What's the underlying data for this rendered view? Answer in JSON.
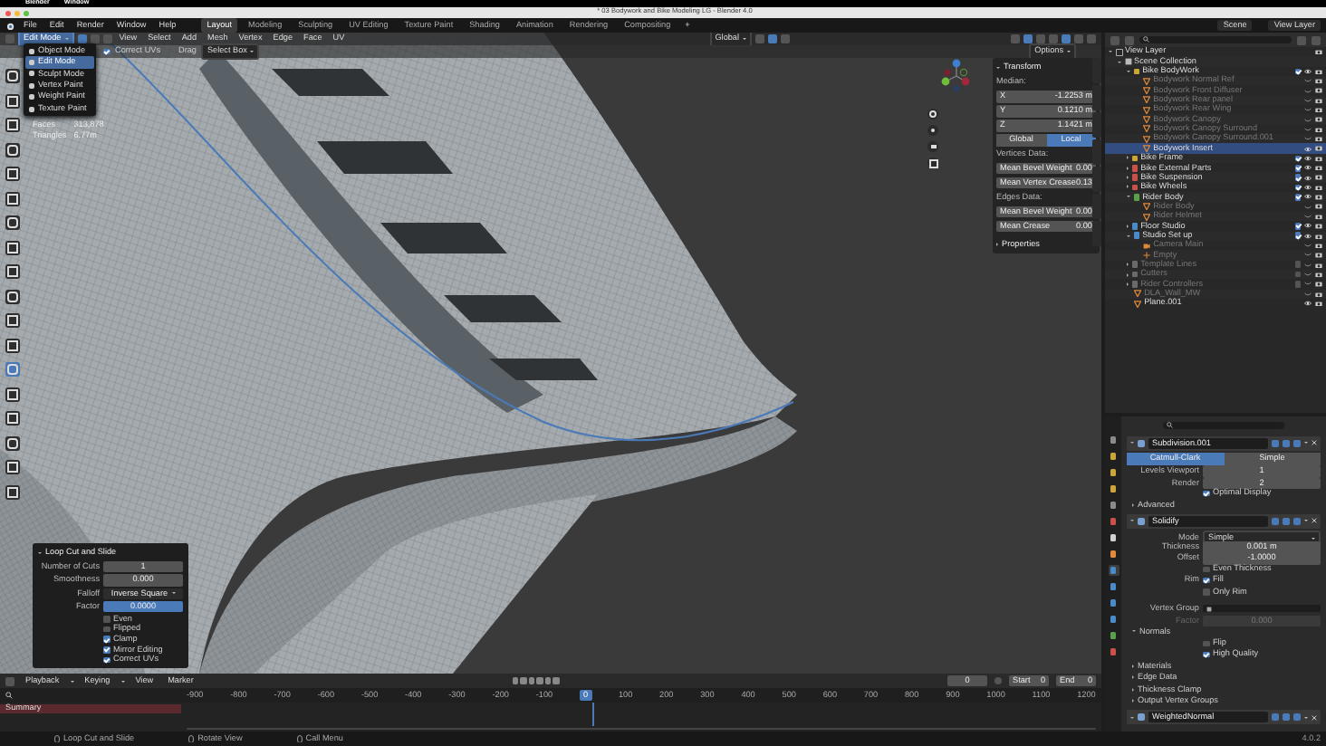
{
  "os_menu": [
    "Blender",
    "Window"
  ],
  "window": {
    "title": "* 03 Bodywork and Bike Modeling LG - Blender 4.0"
  },
  "menu": [
    "File",
    "Edit",
    "Render",
    "Window",
    "Help"
  ],
  "workspaces": [
    {
      "label": "Layout",
      "selected": true
    },
    {
      "label": "Modeling",
      "selected": false
    },
    {
      "label": "Sculpting",
      "selected": false
    },
    {
      "label": "UV Editing",
      "selected": false
    },
    {
      "label": "Texture Paint",
      "selected": false
    },
    {
      "label": "Shading",
      "selected": false
    },
    {
      "label": "Animation",
      "selected": false
    },
    {
      "label": "Rendering",
      "selected": false
    },
    {
      "label": "Compositing",
      "selected": false
    }
  ],
  "add_workspace": "+",
  "scene": "Scene",
  "view_layer": "View Layer",
  "viewport": {
    "mode": "Edit Mode",
    "menus": [
      "View",
      "Select",
      "Add",
      "Mesh",
      "Vertex",
      "Edge",
      "Face",
      "UV"
    ],
    "orientation": "Global",
    "options": "Options",
    "tool_settings": {
      "correct_uvs": {
        "label": "Correct UVs",
        "checked": true
      },
      "drag_label": "Drag",
      "drag_value": "Select Box"
    },
    "mode_menu": [
      {
        "label": "Object Mode",
        "selected": false
      },
      {
        "label": "Edit Mode",
        "selected": true
      },
      {
        "label": "Sculpt Mode",
        "selected": false
      },
      {
        "label": "Vertex Paint",
        "selected": false
      },
      {
        "label": "Weight Paint",
        "selected": false
      },
      {
        "label": "Texture Paint",
        "selected": false
      }
    ],
    "stats": [
      {
        "label": "Faces",
        "value": "313,878"
      },
      {
        "label": "Triangles",
        "value": "6.77m"
      }
    ],
    "sidebar": {
      "title": "Transform",
      "median_label": "Median:",
      "coords": [
        {
          "axis": "X",
          "value": "-1.2253 m"
        },
        {
          "axis": "Y",
          "value": "0.1210 m"
        },
        {
          "axis": "Z",
          "value": "1.1421 m"
        }
      ],
      "space": [
        {
          "label": "Global",
          "selected": false
        },
        {
          "label": "Local",
          "selected": true
        }
      ],
      "sections": [
        {
          "title": "Vertices Data:",
          "rows": [
            {
              "label": "Mean Bevel Weight",
              "value": "0.00"
            },
            {
              "label": "Mean Vertex Crease",
              "value": "0.13"
            }
          ]
        },
        {
          "title": "Edges Data:",
          "rows": [
            {
              "label": "Mean Bevel Weight",
              "value": "0.00"
            },
            {
              "label": "Mean Crease",
              "value": "0.00"
            }
          ]
        }
      ],
      "properties_title": "Properties"
    },
    "operator_panel": {
      "title": "Loop Cut and Slide",
      "fields": [
        {
          "label": "Number of Cuts",
          "value": "1",
          "kind": "number"
        },
        {
          "label": "Smoothness",
          "value": "0.000",
          "kind": "number"
        },
        {
          "label": "Falloff",
          "value": "Inverse Square",
          "kind": "dropdown"
        },
        {
          "label": "Factor",
          "value": "0.0000",
          "kind": "active"
        }
      ],
      "options": [
        {
          "label": "Even",
          "checked": false
        },
        {
          "label": "Flipped",
          "checked": false
        },
        {
          "label": "Clamp",
          "checked": true
        },
        {
          "label": "Mirror Editing",
          "checked": true
        },
        {
          "label": "Correct UVs",
          "checked": true
        }
      ]
    }
  },
  "outliner": {
    "items": [
      {
        "label": "View Layer",
        "kind": "view_layer",
        "selected": false,
        "hidden": false,
        "children": [
          {
            "label": "Scene Collection",
            "kind": "scene_collection",
            "selected": false,
            "hidden": false,
            "children": [
              {
                "label": "Bike BodyWork",
                "kind": "collection",
                "color": "#c9a53a",
                "included": true,
                "selected": false,
                "hidden": false,
                "children": [
                  {
                    "label": "Bodywork Normal Ref",
                    "kind": "object",
                    "selected": false,
                    "hidden": true
                  },
                  {
                    "label": "Bodywork Front Diffuser",
                    "kind": "object",
                    "selected": false,
                    "hidden": true
                  },
                  {
                    "label": "Bodywork Rear panel",
                    "kind": "object",
                    "selected": false,
                    "hidden": true
                  },
                  {
                    "label": "Bodywork Rear Wing",
                    "kind": "object",
                    "selected": false,
                    "hidden": true
                  },
                  {
                    "label": "Bodywork Canopy",
                    "kind": "object",
                    "selected": false,
                    "hidden": true
                  },
                  {
                    "label": "Bodywork Canopy Surround",
                    "kind": "object",
                    "selected": false,
                    "hidden": true
                  },
                  {
                    "label": "Bodywork Canopy Surround.001",
                    "kind": "object",
                    "selected": false,
                    "hidden": true
                  },
                  {
                    "label": "Bodywork Insert",
                    "kind": "object",
                    "selected": true,
                    "hidden": false
                  }
                ]
              },
              {
                "label": "Bike Frame",
                "kind": "collection",
                "color": "#c9a53a",
                "included": true,
                "selected": false,
                "hidden": false
              },
              {
                "label": "Bike External Parts",
                "kind": "collection",
                "color": "#c8524a",
                "included": true,
                "selected": false,
                "hidden": false
              },
              {
                "label": "Bike Suspension",
                "kind": "collection",
                "color": "#c8524a",
                "included": true,
                "selected": false,
                "hidden": false
              },
              {
                "label": "Bike Wheels",
                "kind": "collection",
                "color": "#c8524a",
                "included": true,
                "selected": false,
                "hidden": false
              },
              {
                "label": "Rider Body",
                "kind": "collection",
                "color": "#5aa04a",
                "included": true,
                "selected": false,
                "hidden": false,
                "children": [
                  {
                    "label": "Rider Body",
                    "kind": "object",
                    "selected": false,
                    "hidden": true
                  },
                  {
                    "label": "Rider Helmet",
                    "kind": "object",
                    "selected": false,
                    "hidden": true
                  }
                ]
              },
              {
                "label": "Floor Studio",
                "kind": "collection",
                "color": "#4a8ac8",
                "included": true,
                "selected": false,
                "hidden": false
              },
              {
                "label": "Studio Set up",
                "kind": "collection",
                "color": "#4a8ac8",
                "included": true,
                "selected": false,
                "hidden": false,
                "children": [
                  {
                    "label": "Camera Main",
                    "kind": "camera",
                    "selected": false,
                    "hidden": true
                  },
                  {
                    "label": "Empty",
                    "kind": "empty",
                    "selected": false,
                    "hidden": true
                  }
                ]
              },
              {
                "label": "Template Lines",
                "kind": "collection",
                "color": "#6a6a6a",
                "included": false,
                "selected": false,
                "hidden": true
              },
              {
                "label": "Cutters",
                "kind": "collection",
                "color": "#6a6a6a",
                "included": false,
                "selected": false,
                "hidden": true
              },
              {
                "label": "Rider Controllers",
                "kind": "collection",
                "color": "#6a6a6a",
                "included": false,
                "selected": false,
                "hidden": true
              },
              {
                "label": "DLA_Wall_MW",
                "kind": "object",
                "selected": false,
                "hidden": true
              },
              {
                "label": "Plane.001",
                "kind": "object",
                "selected": false,
                "hidden": false
              }
            ]
          }
        ]
      }
    ]
  },
  "properties_tabs": [
    {
      "kind": "tool",
      "selected": false
    },
    {
      "kind": "render",
      "selected": false
    },
    {
      "kind": "output",
      "selected": false
    },
    {
      "kind": "view",
      "selected": false
    },
    {
      "kind": "scene",
      "selected": false
    },
    {
      "kind": "world",
      "selected": false
    },
    {
      "kind": "collection",
      "selected": false
    },
    {
      "kind": "object",
      "selected": false
    },
    {
      "kind": "modifier",
      "selected": true
    },
    {
      "kind": "particles",
      "selected": false
    },
    {
      "kind": "physics",
      "selected": false
    },
    {
      "kind": "constraints",
      "selected": false
    },
    {
      "kind": "data",
      "selected": false
    },
    {
      "kind": "material",
      "selected": false
    }
  ],
  "modifiers": [
    {
      "name": "Subdivision.001",
      "rows": [
        {
          "kind": "method_tabs",
          "options": [
            {
              "label": "Catmull-Clark",
              "selected": true
            },
            {
              "label": "Simple",
              "selected": false
            }
          ]
        },
        {
          "kind": "field",
          "label": "Levels Viewport",
          "value": "1"
        },
        {
          "kind": "field",
          "label": "Render",
          "value": "2"
        },
        {
          "kind": "check",
          "label": "Optimal Display",
          "checked": true
        },
        {
          "kind": "subpanel",
          "label": "Advanced",
          "expanded": false
        }
      ]
    },
    {
      "name": "Solidify",
      "rows": [
        {
          "kind": "dropdown",
          "label": "Mode",
          "value": "Simple"
        },
        {
          "kind": "field",
          "label": "Thickness",
          "value": "0.001 m"
        },
        {
          "kind": "field",
          "label": "Offset",
          "value": "-1.0000"
        },
        {
          "kind": "check",
          "label": "Even Thickness",
          "checked": false
        },
        {
          "kind": "check",
          "group_label": "Rim",
          "label": "Fill",
          "checked": true
        },
        {
          "kind": "check",
          "label": "Only Rim",
          "checked": false
        },
        {
          "kind": "vertex_group",
          "label": "Vertex Group"
        },
        {
          "kind": "field",
          "label": "Factor",
          "value": "0.000",
          "disabled": true
        },
        {
          "kind": "subpanel",
          "label": "Normals",
          "expanded": true,
          "rows": [
            {
              "kind": "check",
              "label": "Flip",
              "checked": false
            },
            {
              "kind": "check",
              "label": "High Quality",
              "checked": true
            }
          ]
        },
        {
          "kind": "subpanel",
          "label": "Materials",
          "expanded": false
        },
        {
          "kind": "subpanel",
          "label": "Edge Data",
          "expanded": false
        },
        {
          "kind": "subpanel",
          "label": "Thickness Clamp",
          "expanded": false
        },
        {
          "kind": "subpanel",
          "label": "Output Vertex Groups",
          "expanded": false
        }
      ]
    },
    {
      "name": "WeightedNormal"
    }
  ],
  "timeline": {
    "menus": [
      "Playback",
      "Keying",
      "View",
      "Marker"
    ],
    "channel": "Summary",
    "frame": "0",
    "start_label": "Start",
    "start": "0",
    "end_label": "End",
    "end": "0",
    "ticks_before": [
      "-900",
      "-800",
      "-700",
      "-600",
      "-500",
      "-400",
      "-300",
      "-200",
      "-100"
    ],
    "current_frame": "0",
    "ticks_after": [
      "100",
      "200",
      "300",
      "400",
      "500",
      "600",
      "700",
      "800",
      "900",
      "1000",
      "1100",
      "1200"
    ]
  },
  "status_bar": [
    {
      "label": "Loop Cut and Slide"
    },
    {
      "label": "Rotate View"
    },
    {
      "label": "Call Menu"
    }
  ],
  "version": "4.0.2"
}
